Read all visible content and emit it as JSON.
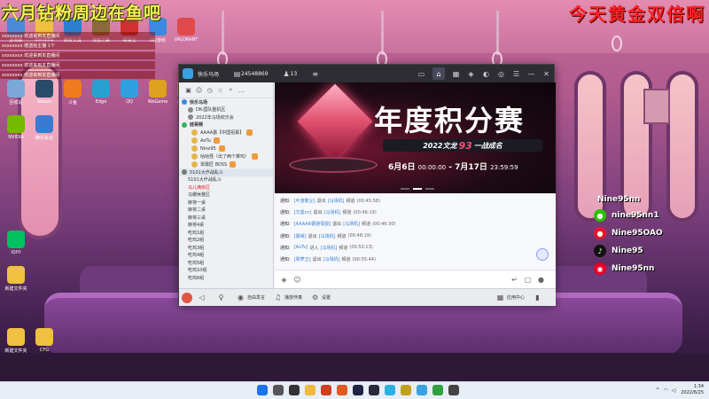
{
  "overlays": {
    "left_text": "六月钻粉周边在鱼吧",
    "right_text": "今天黄金双倍啊"
  },
  "chat_ticker": [
    "xxxxxxxx 欢迎来到本直播间",
    "xxxxxxxx 赠送给主播 1个",
    "xxxxxxxx 欢迎来到本直播间",
    "xxxxxxxx 欢迎来到本直播间",
    "xxxxxxxx 欢迎来到本直播间"
  ],
  "desktop_icons": [
    {
      "label": "此电脑",
      "color": "#4a8ad8"
    },
    {
      "label": "Bandizip",
      "color": "#f0c040"
    },
    {
      "label": "微软工具",
      "color": "#2c7fd0"
    },
    {
      "label": "流放之路",
      "color": "#8a6a3a"
    },
    {
      "label": "网易云",
      "color": "#d03030"
    },
    {
      "label": "QQ游戏",
      "color": "#3a8ae0"
    },
    {
      "label": "VALORANT",
      "color": "#e04a4a"
    },
    {
      "label": "回收站",
      "color": "#7aa8d8"
    },
    {
      "label": "Steam",
      "color": "#2a4a6a"
    },
    {
      "label": "斗鱼",
      "color": "#f07a20"
    },
    {
      "label": "Edge",
      "color": "#2aa0d0"
    },
    {
      "label": "QQ",
      "color": "#30a0e0"
    },
    {
      "label": "WeGame",
      "color": "#e0a020"
    },
    {
      "label": "英雄联盟",
      "color": "#c09a40"
    },
    {
      "label": "NVIDIA",
      "color": "#76b900"
    },
    {
      "label": "腾讯会议",
      "color": "#3a7ad0"
    },
    {
      "label": "iQIYI",
      "color": "#00c060"
    },
    {
      "label": "新建文件夹",
      "color": "#f0c040"
    },
    {
      "label": "新建文件夹",
      "color": "#f0c040"
    },
    {
      "label": "CFG",
      "color": "#f0c040"
    }
  ],
  "social": {
    "nick": "Nine95nn",
    "items": [
      {
        "icon": "wechat-icon",
        "color": "#2dc100",
        "glyph": "●",
        "text": "nine95nn1"
      },
      {
        "icon": "weibo-icon",
        "color": "#e6162d",
        "glyph": "●",
        "text": "Nine95OAO"
      },
      {
        "icon": "tiktok-icon",
        "color": "#111111",
        "glyph": "♪",
        "text": "Nine95"
      },
      {
        "icon": "netease-music-icon",
        "color": "#e60026",
        "glyph": "◉",
        "text": "Nine95nn"
      }
    ]
  },
  "app": {
    "title": "快乐马场",
    "room_id": "24548869",
    "online_count": "13",
    "channels": [
      {
        "text": "快乐马场",
        "type": "head",
        "dot": "#3a8ae0"
      },
      {
        "text": "DK-国队整机区",
        "type": "sub",
        "dot": "#888888"
      },
      {
        "text": "2022年马场欢乐会",
        "type": "sub",
        "dot": "#888888"
      },
      {
        "text": "娃哥频",
        "type": "head",
        "dot": "#3ab060"
      }
    ],
    "users": [
      {
        "text": "AAAA蕾【中国招募】"
      },
      {
        "text": "AoTu"
      },
      {
        "text": "Nine95"
      },
      {
        "text": "咕咕怪（出了两个菜鸡）"
      },
      {
        "text": "翠蕾匠 BOSS"
      }
    ],
    "channels2": [
      {
        "text": "5101大作战乱斗",
        "type": "highlight",
        "dot": "#777777"
      },
      {
        "text": "5101大作战乱斗",
        "type": "sub",
        "dot": ""
      },
      {
        "text": "马儿满房区",
        "type": "sub red",
        "dot": ""
      },
      {
        "text": "马栅休整区",
        "type": "sub",
        "dot": ""
      },
      {
        "text": "麻将一桌",
        "type": "sub",
        "dot": ""
      },
      {
        "text": "麻将二桌",
        "type": "sub",
        "dot": ""
      },
      {
        "text": "麻将三桌",
        "type": "sub",
        "dot": ""
      },
      {
        "text": "麻将4桌",
        "type": "sub",
        "dot": ""
      },
      {
        "text": "吃鸡1组",
        "type": "sub",
        "dot": ""
      },
      {
        "text": "吃鸡2组",
        "type": "sub",
        "dot": ""
      },
      {
        "text": "吃鸡3组",
        "type": "sub",
        "dot": ""
      },
      {
        "text": "吃鸡4组",
        "type": "sub",
        "dot": ""
      },
      {
        "text": "吃鸡5组",
        "type": "sub",
        "dot": ""
      },
      {
        "text": "吃鸡10组",
        "type": "sub",
        "dot": ""
      },
      {
        "text": "吃鸡6组",
        "type": "sub",
        "dot": ""
      }
    ],
    "banner": {
      "title": "年度积分赛",
      "sub_prefix": "2022文龙",
      "sub_num": "93",
      "sub_suffix": "一战成名",
      "date_main": "6月6日",
      "date_time1": "00:00:00",
      "date_sep": " - ",
      "date_main2": "7月17日",
      "date_time2": "23:59:59"
    },
    "chat": [
      {
        "sys": "通知:",
        "name": "[叶落繁尘]",
        "act": "退出",
        "channel": "[马场机]",
        "verb": "频道",
        "time": "(00:45:58)"
      },
      {
        "sys": "通知:",
        "name": "[华曼cn]",
        "act": "退出",
        "channel": "[马场机]",
        "verb": "频道",
        "time": "(00:46:19)"
      },
      {
        "sys": "通知:",
        "name": "[AAAAR蕾驰情报]",
        "act": "退出",
        "channel": "[马场机]",
        "verb": "频道",
        "time": "(00:46:30)"
      },
      {
        "sys": "通知:",
        "name": "[蕾晴]",
        "act": "退出",
        "channel": "[马场机]",
        "verb": "频道",
        "time": "(00:48:19)"
      },
      {
        "sys": "通知:",
        "name": "[AoTu]",
        "act": "进入",
        "channel": "[马场机]",
        "verb": "频道",
        "time": "(00:50:13)"
      },
      {
        "sys": "通知:",
        "name": "[翠萝卫]",
        "act": "退出",
        "channel": "[马场机]",
        "verb": "频道",
        "time": "(00:55:44)"
      }
    ],
    "input_placeholder": "",
    "bottom": {
      "item1": "自由发言",
      "item2": "播放伴奏",
      "item3": "设置",
      "item4": "应用中心"
    }
  },
  "taskbar": {
    "apps": [
      {
        "name": "windows-start-icon",
        "color": "#1a73e8"
      },
      {
        "name": "search-icon",
        "color": "#555555"
      },
      {
        "name": "task-view-icon",
        "color": "#333333"
      },
      {
        "name": "explorer-icon",
        "color": "#f0b840"
      },
      {
        "name": "store-icon",
        "color": "#d04020"
      },
      {
        "name": "app-icon-1",
        "color": "#e05a20"
      },
      {
        "name": "app-icon-2",
        "color": "#222244"
      },
      {
        "name": "app-icon-3",
        "color": "#2a2a3a"
      },
      {
        "name": "app-icon-4",
        "color": "#2db0e0"
      },
      {
        "name": "app-icon-5",
        "color": "#c0a020"
      },
      {
        "name": "app-icon-6",
        "color": "#3aa0e0"
      },
      {
        "name": "app-icon-7",
        "color": "#30a040"
      },
      {
        "name": "app-icon-8",
        "color": "#444444"
      }
    ],
    "clock_time": "1:34",
    "clock_date": "2022/6/25"
  }
}
